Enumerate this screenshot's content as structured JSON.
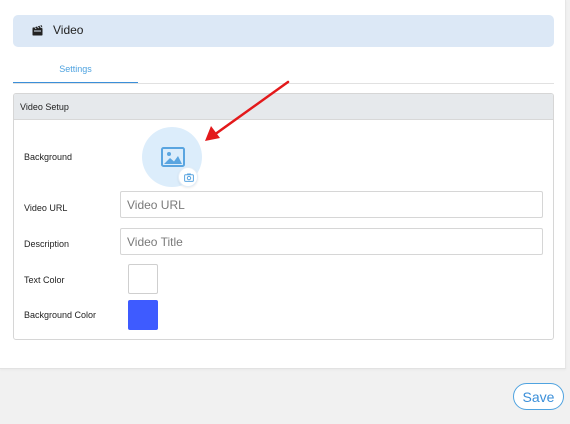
{
  "header": {
    "title": "Video",
    "icon": "video-clapper-icon"
  },
  "tabs": [
    {
      "label": "Settings",
      "active": true
    }
  ],
  "section": {
    "title": "Video Setup",
    "fields": {
      "background": {
        "label": "Background",
        "icon": "image-placeholder-icon",
        "upload_icon": "camera-icon"
      },
      "video_url": {
        "label": "Video URL",
        "value": "",
        "placeholder": "Video URL"
      },
      "description": {
        "label": "Description",
        "value": "",
        "placeholder": "Video Title"
      },
      "text_color": {
        "label": "Text Color",
        "color": "#ffffff"
      },
      "background_color": {
        "label": "Background Color",
        "color": "#3e5bff"
      }
    }
  },
  "annotation": {
    "type": "arrow",
    "color": "#e3191b"
  },
  "footer": {
    "save_label": "Save"
  },
  "colors": {
    "accent": "#3b8fd9",
    "header_bg": "#dce8f6"
  }
}
